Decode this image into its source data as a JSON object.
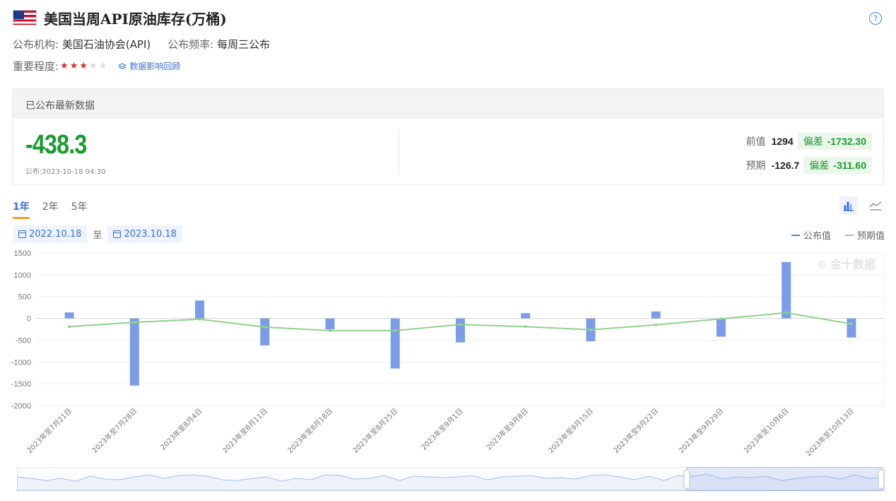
{
  "header": {
    "title": "美国当周API原油库存(万桶)",
    "help_symbol": "?"
  },
  "meta": {
    "org_label": "公布机构:",
    "org_value": "美国石油协会(API)",
    "freq_label": "公布频率:",
    "freq_value": "每周三公布",
    "importance_label": "重要程度:",
    "importance_stars": 3,
    "importance_max": 5,
    "review_link": "数据影响回顾"
  },
  "panel": {
    "heading": "已公布最新数据",
    "actual": "-438.3",
    "publish_time": "公布:2023-10-18 04:30",
    "previous_label": "前值",
    "previous_value": "1294",
    "previous_diff_label": "偏差",
    "previous_diff_value": "-1732.30",
    "forecast_label": "预期",
    "forecast_value": "-126.7",
    "forecast_diff_label": "偏差",
    "forecast_diff_value": "-311.60"
  },
  "tabs": [
    {
      "label": "1年",
      "active": true
    },
    {
      "label": "2年",
      "active": false
    },
    {
      "label": "5年",
      "active": false
    }
  ],
  "date_range": {
    "start": "2022.10.18",
    "separator": "至",
    "end": "2023.10.18"
  },
  "legend": {
    "actual": "公布值",
    "forecast": "预期值"
  },
  "watermark": "金十数据",
  "colors": {
    "bar": "#7b9ce8",
    "forecast_line": "#8ed38a",
    "positive_green": "#1a9c2f",
    "accent": "#3b6fd8"
  },
  "chart_data": {
    "type": "bar",
    "categories": [
      "2023年至7月21日",
      "2023年至7月28日",
      "2023年至8月4日",
      "2023年至8月11日",
      "2023年至8月18日",
      "2023年至8月25日",
      "2023年至9月1日",
      "2023年至9月8日",
      "2023年至9月15日",
      "2023年至9月22日",
      "2023年至9月29日",
      "2023年至10月6日",
      "2023年至10月13日"
    ],
    "series": [
      {
        "name": "公布值",
        "type": "bar",
        "values": [
          136,
          -1540,
          410,
          -620,
          -250,
          -1150,
          -550,
          120,
          -525,
          160,
          -420,
          1294,
          -438.3
        ]
      },
      {
        "name": "预期值",
        "type": "line",
        "values": [
          -190,
          -90,
          -20,
          -200,
          -280,
          -280,
          -140,
          -190,
          -260,
          -150,
          -10,
          130,
          -126.7
        ]
      }
    ],
    "ylim": [
      -2000,
      1500
    ],
    "yticks": [
      1500,
      1000,
      500,
      0,
      -500,
      -1000,
      -1500,
      -2000
    ],
    "grid": true,
    "legend_position": "top-right"
  }
}
